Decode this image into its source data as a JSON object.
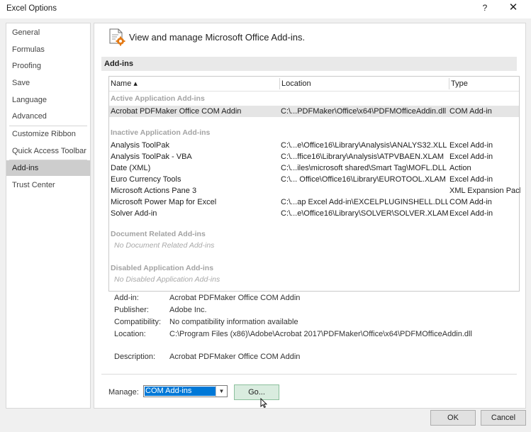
{
  "window": {
    "title": "Excel Options",
    "help": "?",
    "close": "✕"
  },
  "nav": {
    "items": [
      "General",
      "Formulas",
      "Proofing",
      "Save",
      "Language",
      "Advanced",
      "Customize Ribbon",
      "Quick Access Toolbar",
      "Add-ins",
      "Trust Center"
    ],
    "selected": "Add-ins"
  },
  "header": {
    "text": "View and manage Microsoft Office Add-ins."
  },
  "section": {
    "title": "Add-ins"
  },
  "grid": {
    "columns": {
      "name": "Name ▴",
      "location": "Location",
      "type": "Type"
    },
    "groups": {
      "active": "Active Application Add-ins",
      "inactive": "Inactive Application Add-ins",
      "document": "Document Related Add-ins",
      "disabled": "Disabled Application Add-ins"
    },
    "active_rows": [
      {
        "name": "Acrobat PDFMaker Office COM Addin",
        "location": "C:\\...PDFMaker\\Office\\x64\\PDFMOfficeAddin.dll",
        "type": "COM Add-in"
      }
    ],
    "inactive_rows": [
      {
        "name": "Analysis ToolPak",
        "location": "C:\\...e\\Office16\\Library\\Analysis\\ANALYS32.XLL",
        "type": "Excel Add-in"
      },
      {
        "name": "Analysis ToolPak - VBA",
        "location": "C:\\...ffice16\\Library\\Analysis\\ATPVBAEN.XLAM",
        "type": "Excel Add-in"
      },
      {
        "name": "Date (XML)",
        "location": "C:\\...iles\\microsoft shared\\Smart Tag\\MOFL.DLL",
        "type": "Action"
      },
      {
        "name": "Euro Currency Tools",
        "location": "C:\\... Office\\Office16\\Library\\EUROTOOL.XLAM",
        "type": "Excel Add-in"
      },
      {
        "name": "Microsoft Actions Pane 3",
        "location": "",
        "type": "XML Expansion Pack"
      },
      {
        "name": "Microsoft Power Map for Excel",
        "location": "C:\\...ap Excel Add-in\\EXCELPLUGINSHELL.DLL",
        "type": "COM Add-in"
      },
      {
        "name": "Solver Add-in",
        "location": "C:\\...e\\Office16\\Library\\SOLVER\\SOLVER.XLAM",
        "type": "Excel Add-in"
      }
    ],
    "document_empty": "No Document Related Add-ins",
    "disabled_empty": "No Disabled Application Add-ins"
  },
  "details": {
    "addin_label": "Add-in:",
    "addin_value": "Acrobat PDFMaker Office COM Addin",
    "publisher_label": "Publisher:",
    "publisher_value": "Adobe Inc.",
    "compat_label": "Compatibility:",
    "compat_value": "No compatibility information available",
    "location_label": "Location:",
    "location_value": "C:\\Program Files (x86)\\Adobe\\Acrobat 2017\\PDFMaker\\Office\\x64\\PDFMOfficeAddin.dll",
    "description_label": "Description:",
    "description_value": "Acrobat PDFMaker Office COM Addin"
  },
  "manage": {
    "label": "Manage:",
    "selected": "COM Add-ins",
    "go": "Go..."
  },
  "buttons": {
    "ok": "OK",
    "cancel": "Cancel"
  },
  "colors": {
    "selection_blue": "#0078d7",
    "go_green": "#d9ecdf",
    "nav_selected": "#cdcdcd"
  }
}
